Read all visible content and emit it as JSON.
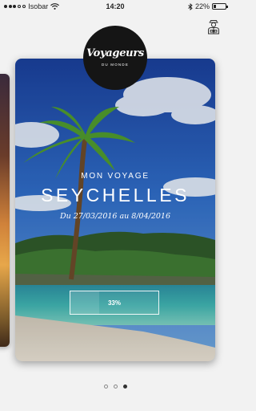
{
  "status_bar": {
    "carrier": "Isobar",
    "time": "14:20",
    "battery": "22%",
    "battery_level": 0.22,
    "icons": [
      "signal-dots-icon",
      "wifi-icon",
      "bluetooth-icon",
      "battery-icon"
    ]
  },
  "header": {
    "profile_icon": "traveler-person-icon"
  },
  "logo": {
    "name": "Voyageurs",
    "subtitle": "DU MONDE"
  },
  "card": {
    "overline": "MON VOYAGE",
    "destination": "SEYCHELLES",
    "dates": "Du 27/03/2016 au 8/04/2016",
    "progress_label": "33%",
    "progress_value": 0.33
  },
  "pager": {
    "count": 3,
    "active_index": 2
  },
  "colors": {
    "background": "#f2f2f2",
    "logo_bg": "#151515",
    "text_on_image": "#ffffff"
  }
}
